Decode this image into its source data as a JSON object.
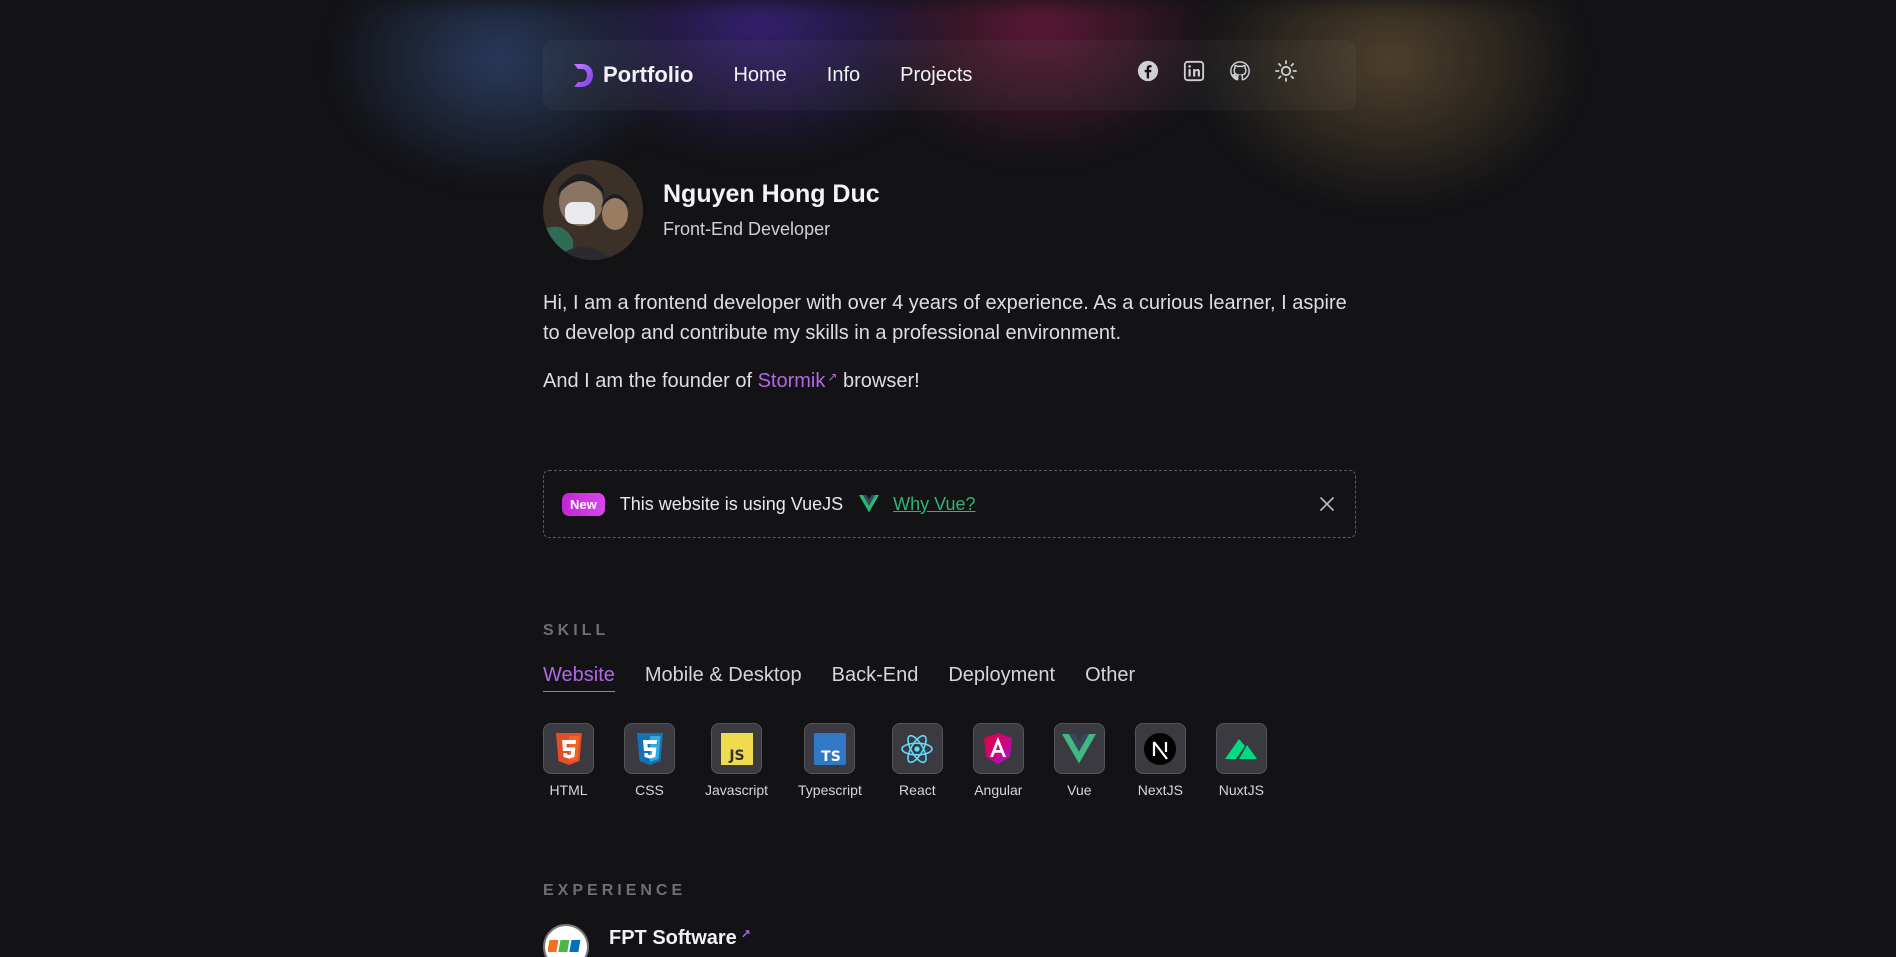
{
  "nav": {
    "brand": "Portfolio",
    "links": [
      "Home",
      "Info",
      "Projects"
    ],
    "icons": [
      "facebook-icon",
      "linkedin-icon",
      "github-icon",
      "sun-icon"
    ]
  },
  "profile": {
    "name": "Nguyen Hong Duc",
    "role": "Front-End Developer",
    "bio": "Hi, I am a frontend developer with over 4 years of experience. As a curious learner, I aspire to develop and contribute my skills in a professional environment.",
    "founder_prefix": "And I am the founder of",
    "founder_link": "Stormik",
    "founder_suffix": "browser!"
  },
  "banner": {
    "badge": "New",
    "text": "This website is using VueJS",
    "link": "Why Vue?"
  },
  "skill": {
    "section_label": "SKILL",
    "tabs": [
      "Website",
      "Mobile & Desktop",
      "Back-End",
      "Deployment",
      "Other"
    ],
    "active_tab": "Website",
    "items": [
      "HTML",
      "CSS",
      "Javascript",
      "Typescript",
      "React",
      "Angular",
      "Vue",
      "NextJS",
      "NuxtJS"
    ]
  },
  "experience": {
    "section_label": "EXPERIENCE",
    "company": "FPT Software"
  },
  "colors": {
    "background": "#131316",
    "accent": "#b267e6",
    "vue_green": "#2fb572",
    "badge": "#c026d3"
  }
}
